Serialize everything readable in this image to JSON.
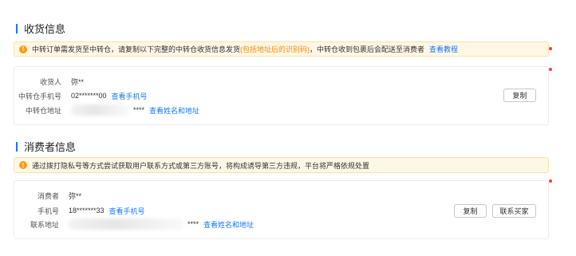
{
  "shipping": {
    "title": "收货信息",
    "notice": {
      "text": "中转订单需发货至中转仓，请复制以下完整的中转仓收货信息发货",
      "highlight": "(包括地址后的识别码)",
      "suffix": "，中转仓收到包裹后会配送至消费者",
      "link": "查看教程"
    },
    "receiver_label": "收货人",
    "receiver_value": "弥**",
    "phone_label": "中转仓手机号",
    "phone_value": "02*******00",
    "phone_link": "查看手机号",
    "address_label": "中转仓地址",
    "address_masked": "****",
    "address_link": "查看姓名和地址",
    "copy_button": "复制"
  },
  "consumer": {
    "title": "消费者信息",
    "notice": {
      "text": "通过拨打隐私号等方式尝试获取用户联系方式或第三方账号，将构成诱导第三方违规，平台将严格依规处置"
    },
    "name_label": "消费者",
    "name_value": "弥**",
    "phone_label": "手机号",
    "phone_value": "18*******33",
    "phone_link": "查看手机号",
    "address_label": "联系地址",
    "address_masked": "****",
    "address_link": "查看姓名和地址",
    "copy_button": "复制",
    "contact_button": "联系买家"
  },
  "colors": {
    "accent": "#1677ff",
    "warning": "#fa9d14",
    "highlight": "#f08c00",
    "notice_bg": "#fff7e6",
    "marker": "#e8413b"
  },
  "icons": [
    "warning-icon",
    "warning-icon"
  ]
}
